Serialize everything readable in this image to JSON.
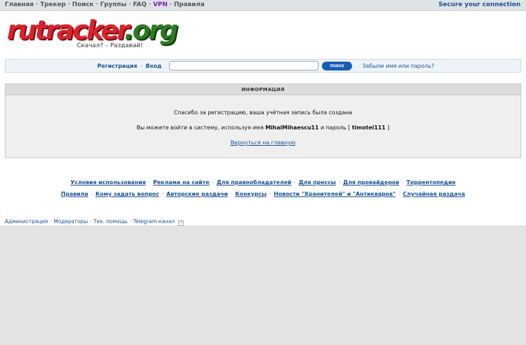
{
  "topnav": {
    "items": [
      "Главная",
      "Трекер",
      "Поиск",
      "Группы",
      "FAQ",
      "VPN",
      "Правила"
    ],
    "secure_label": "Secure your connection"
  },
  "logo": {
    "text_main": "rutracker",
    "text_org": ".org",
    "slogan": "Скачал? – Раздавай!"
  },
  "login": {
    "register_label": "Регистрация",
    "login_label": "Вход",
    "search_placeholder": "",
    "search_button": "поиск",
    "forgot_label": "Забыли имя или пароль?"
  },
  "info": {
    "header": "ИНФОРМАЦИЯ",
    "message": "Спасибо за регистрацию, ваша учётная запись была создана",
    "login_prefix": "Вы можете войти в систему, используя имя",
    "username": "MihaiMihaescu11",
    "password_prefix": "и пароль [",
    "password": "timotei111",
    "password_suffix": "]",
    "back_link": "Вернуться на главную"
  },
  "footer": {
    "row1": [
      "Условия использования",
      "Реклама на сайте",
      "Для правообладателей",
      "Для прессы",
      "Для провайдеров",
      "Торрентопедия"
    ],
    "row2": [
      "Правила",
      "Кому задать вопрос",
      "Авторские раздачи",
      "Конкурсы",
      "Новости \"Хранителей\" и \"Антикваров\"",
      "Случайная раздача"
    ]
  },
  "bottomnav": {
    "items": [
      "Администрация",
      "Модераторы",
      "Тех. помощь",
      "Telegram-канал"
    ]
  },
  "colors": {
    "link": "#1a5294",
    "vpn": "#7a1fa2",
    "logo_red": "#d8242c",
    "logo_green": "#2c7a22",
    "search_button": "#1a5eb4"
  }
}
